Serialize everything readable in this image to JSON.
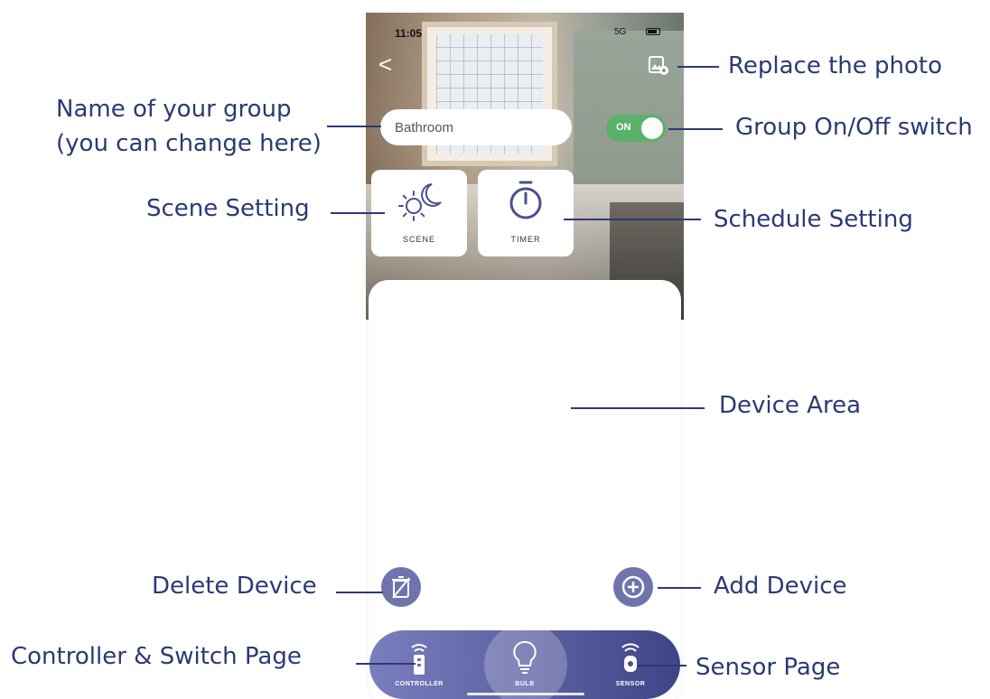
{
  "status_bar": {
    "time": "11:05",
    "signal": "5G"
  },
  "header": {
    "back_glyph": "<"
  },
  "group": {
    "name": "Bathroom",
    "toggle_label": "ON",
    "toggle_on": true
  },
  "tiles": {
    "scene_label": "SCENE",
    "timer_label": "TIMER"
  },
  "nav": {
    "controller_label": "CONTROLLER",
    "bulb_label": "BULB",
    "sensor_label": "SENSOR",
    "active": "bulb"
  },
  "callouts": {
    "replace_photo": "Replace the photo",
    "group_name_line1": "Name of your group",
    "group_name_line2": "(you can change here)",
    "group_switch": "Group On/Off switch",
    "scene_setting": "Scene Setting",
    "schedule_setting": "Schedule Setting",
    "device_area": "Device Area",
    "delete_device": "Delete Device",
    "add_device": "Add Device",
    "controller_page": "Controller & Switch Page",
    "sensor_page": "Sensor Page"
  },
  "colors": {
    "annotation": "#2b3a73",
    "toggle_on": "#5bb06a",
    "action_button": "#6f74ad",
    "nav_start": "#7a7ebe",
    "nav_end": "#3f4488"
  },
  "icons": {
    "replace_photo": "image-replace-icon",
    "scene": "sun-moon-icon",
    "timer": "stopwatch-icon",
    "delete": "delete-device-icon",
    "add": "plus-circle-icon",
    "controller": "remote-controller-icon",
    "bulb": "light-bulb-icon",
    "sensor": "sensor-icon"
  }
}
